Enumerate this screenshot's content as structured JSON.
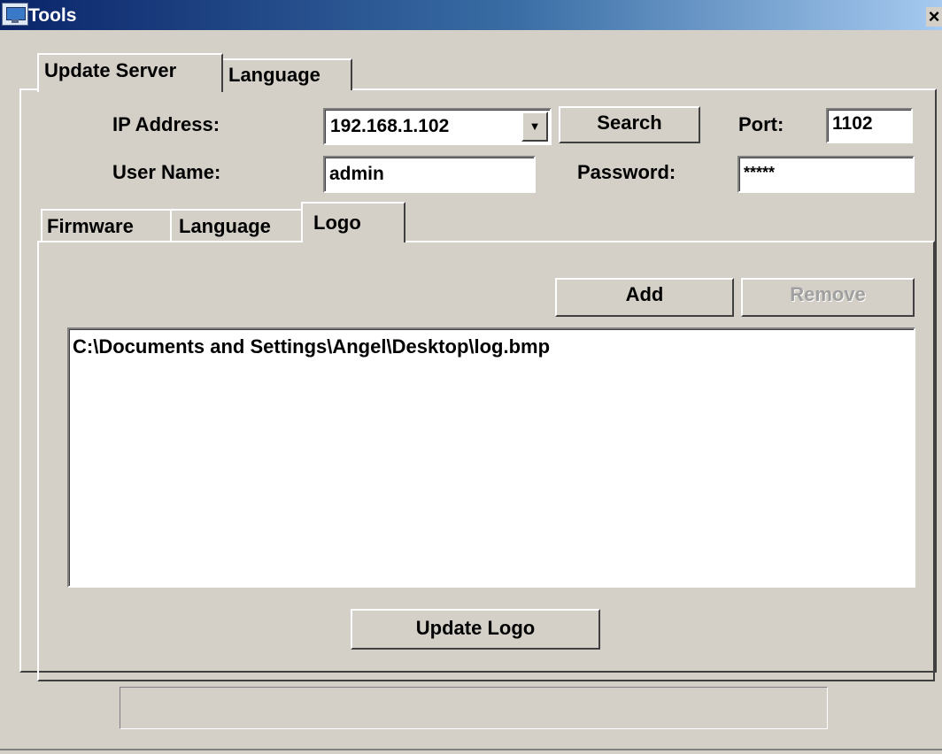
{
  "window": {
    "title": "Tools",
    "close_glyph": "×",
    "icon": "app-monitor-icon"
  },
  "outer_tabs": [
    {
      "label": "Update Server",
      "active": true
    },
    {
      "label": "Language",
      "active": false
    }
  ],
  "form": {
    "ip_label": "IP Address:",
    "ip_value": "192.168.1.102",
    "dropdown_glyph": "▼",
    "search_label": "Search",
    "port_label": "Port:",
    "port_value": "1102",
    "username_label": "User Name:",
    "username_value": "admin",
    "password_label": "Password:",
    "password_value": "*****"
  },
  "inner_tabs": [
    {
      "label": "Firmware",
      "active": false
    },
    {
      "label": "Language",
      "active": false
    },
    {
      "label": "Logo",
      "active": true
    }
  ],
  "logo_panel": {
    "add_label": "Add",
    "remove_label": "Remove",
    "remove_enabled": false,
    "files": [
      "C:\\Documents and Settings\\Angel\\Desktop\\log.bmp"
    ],
    "update_label": "Update Logo"
  },
  "status": {
    "progress_text": ""
  },
  "colors": {
    "face": "#d4d0c8",
    "title_start": "#0a246a",
    "title_end": "#a6caf0",
    "disabled_text": "#a0a0a0"
  }
}
